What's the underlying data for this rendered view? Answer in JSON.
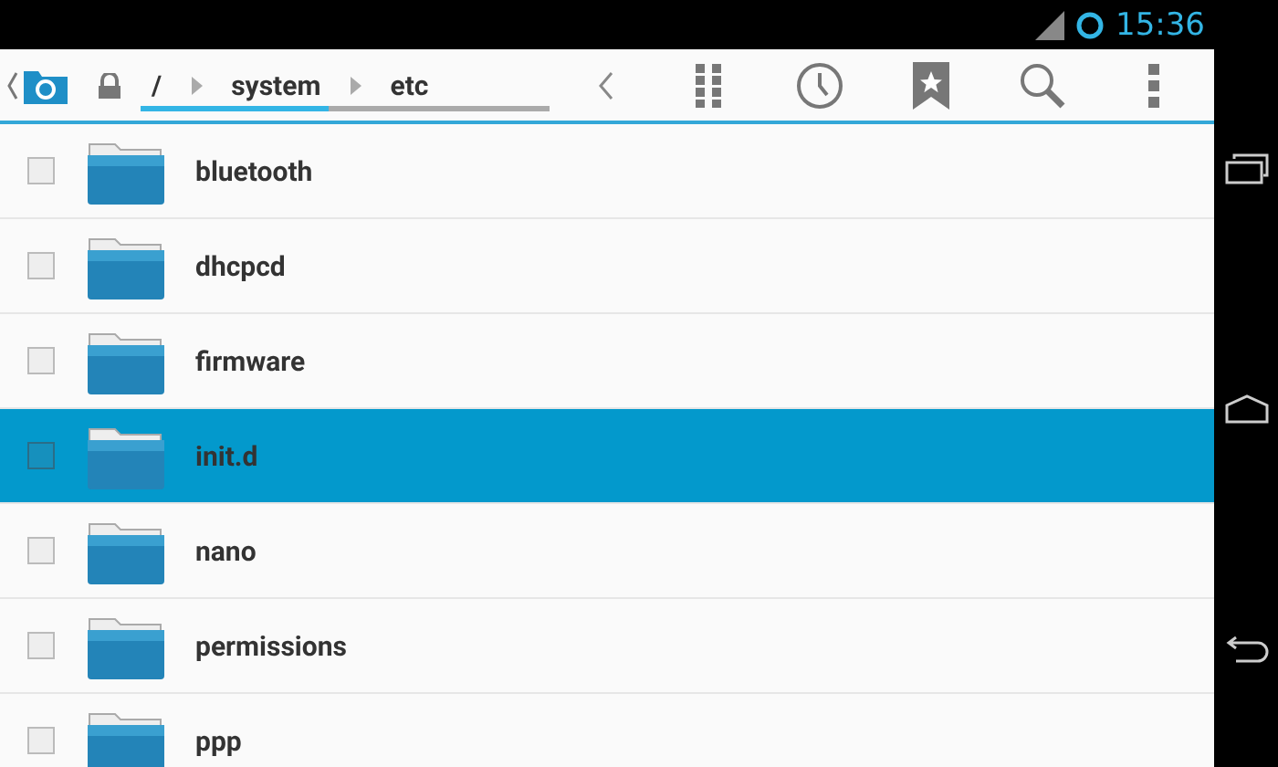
{
  "status_bar": {
    "time": "15:36"
  },
  "breadcrumb": {
    "level": 0.46,
    "crumbs": [
      {
        "label": "/"
      },
      {
        "label": "system"
      },
      {
        "label": "etc"
      }
    ]
  },
  "files": [
    {
      "name": "bluetooth",
      "checked": false,
      "selected": false
    },
    {
      "name": "dhcpcd",
      "checked": false,
      "selected": false
    },
    {
      "name": "firmware",
      "checked": false,
      "selected": false
    },
    {
      "name": "init.d",
      "checked": false,
      "selected": true
    },
    {
      "name": "nano",
      "checked": false,
      "selected": false
    },
    {
      "name": "permissions",
      "checked": false,
      "selected": false
    },
    {
      "name": "ppp",
      "checked": false,
      "selected": false
    }
  ]
}
